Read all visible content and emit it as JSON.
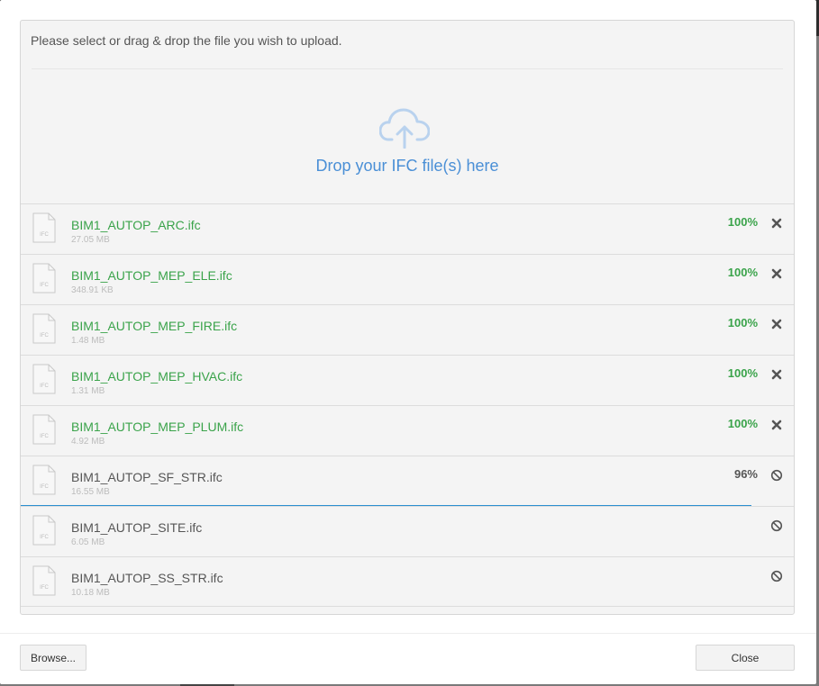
{
  "dialog": {
    "instruction": "Please select or drag & drop the file you wish to upload.",
    "dropzone_text": "Drop your IFC file(s) here",
    "icons": {
      "dropzone": "cloud-upload-icon",
      "file": "ifc-file-icon",
      "remove": "close-icon",
      "cancel": "cancel-icon"
    },
    "file_icon_label": "IFC",
    "colors": {
      "accent": "#4a8fd6",
      "success": "#3aa34a",
      "progress": "#2a8fd0",
      "text": "#555555"
    }
  },
  "files": [
    {
      "name": "BIM1_AUTOP_ARC.ifc",
      "size": "27.05 MB",
      "status": "done",
      "percent": "100%",
      "progress": 1.0
    },
    {
      "name": "BIM1_AUTOP_MEP_ELE.ifc",
      "size": "348.91 KB",
      "status": "done",
      "percent": "100%",
      "progress": 1.0
    },
    {
      "name": "BIM1_AUTOP_MEP_FIRE.ifc",
      "size": "1.48 MB",
      "status": "done",
      "percent": "100%",
      "progress": 1.0
    },
    {
      "name": "BIM1_AUTOP_MEP_HVAC.ifc",
      "size": "1.31 MB",
      "status": "done",
      "percent": "100%",
      "progress": 1.0
    },
    {
      "name": "BIM1_AUTOP_MEP_PLUM.ifc",
      "size": "4.92 MB",
      "status": "done",
      "percent": "100%",
      "progress": 1.0
    },
    {
      "name": "BIM1_AUTOP_SF_STR.ifc",
      "size": "16.55 MB",
      "status": "uploading",
      "percent": "96%",
      "progress": 0.96
    },
    {
      "name": "BIM1_AUTOP_SITE.ifc",
      "size": "6.05 MB",
      "status": "queued",
      "percent": "",
      "progress": 0
    },
    {
      "name": "BIM1_AUTOP_SS_STR.ifc",
      "size": "10.18 MB",
      "status": "queued",
      "percent": "",
      "progress": 0
    }
  ],
  "footer": {
    "browse_label": "Browse...",
    "close_label": "Close"
  }
}
